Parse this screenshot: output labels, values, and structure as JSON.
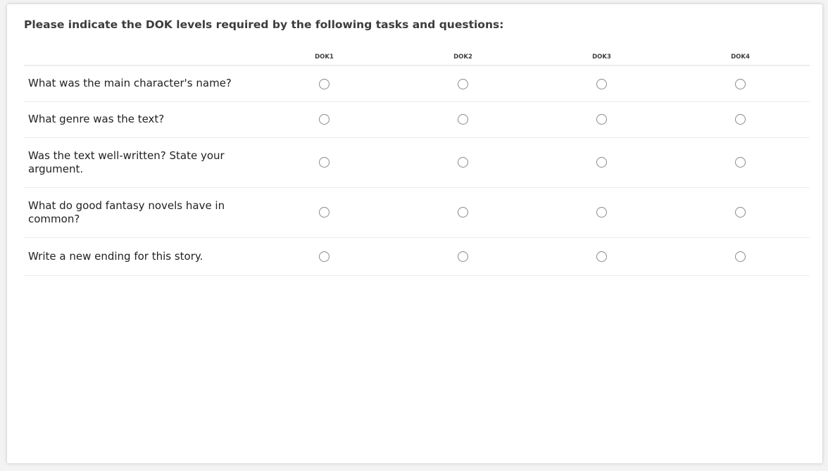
{
  "question": {
    "title": "Please indicate the DOK levels required by the following tasks and questions:"
  },
  "columns": [
    "DOK1",
    "DOK2",
    "DOK3",
    "DOK4"
  ],
  "rows": [
    {
      "statement": "What was the main character's name?",
      "selected": null
    },
    {
      "statement": "What genre was the text?",
      "selected": null
    },
    {
      "statement": "Was the text well-written? State your argument.",
      "selected": null
    },
    {
      "statement": "What do good fantasy novels have in common?",
      "selected": null
    },
    {
      "statement": "Write a new ending for this story.",
      "selected": null
    }
  ]
}
